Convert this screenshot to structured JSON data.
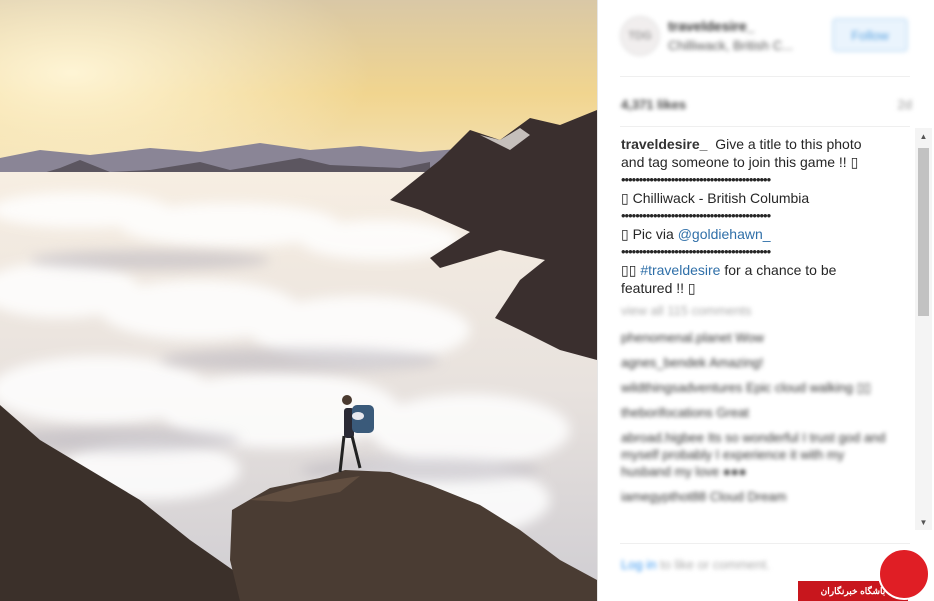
{
  "post": {
    "username": "traveldesire_",
    "location": "Chilliwack, British C...",
    "avatar_text": "TDG",
    "follow_label": "Follow",
    "likes": "4,371 likes",
    "age": "2d"
  },
  "caption": {
    "username": "traveldesire_",
    "line1": "Give a title to this photo",
    "line2": "and tag someone to join this game !! ▯",
    "dots": "••••••••••••••••••••••••••••••••••••••••••",
    "location_line": "▯ Chilliwack - British Columbia",
    "pic_via_prefix": "▯ Pic via ",
    "pic_via_handle": "@goldiehawn_",
    "hashtag_prefix": "▯▯ ",
    "hashtag": "#traveldesire",
    "hashtag_suffix": " for a chance to be",
    "featured": "featured !! ▯"
  },
  "comments": {
    "view_all": "view all 115 comments",
    "items": [
      "phenomenal.planet Wow",
      "agnes_bendek Amazing!",
      "wildthingsadventures Epic cloud walking ▯▯",
      "theborifocations Great",
      "abroad.higbee Its so wonderful I trust god and myself probably I experience it with my husband my love ●●●",
      "iamegypthot88 Cloud Dream"
    ]
  },
  "footer": {
    "login_link": "Log in",
    "login_rest": " to like or comment."
  },
  "watermark": {
    "text": "باشگاه خبرنگاران"
  },
  "colors": {
    "link": "#2f6fa8",
    "follow_text": "#5ba3e0",
    "watermark_red": "#c8161d"
  }
}
